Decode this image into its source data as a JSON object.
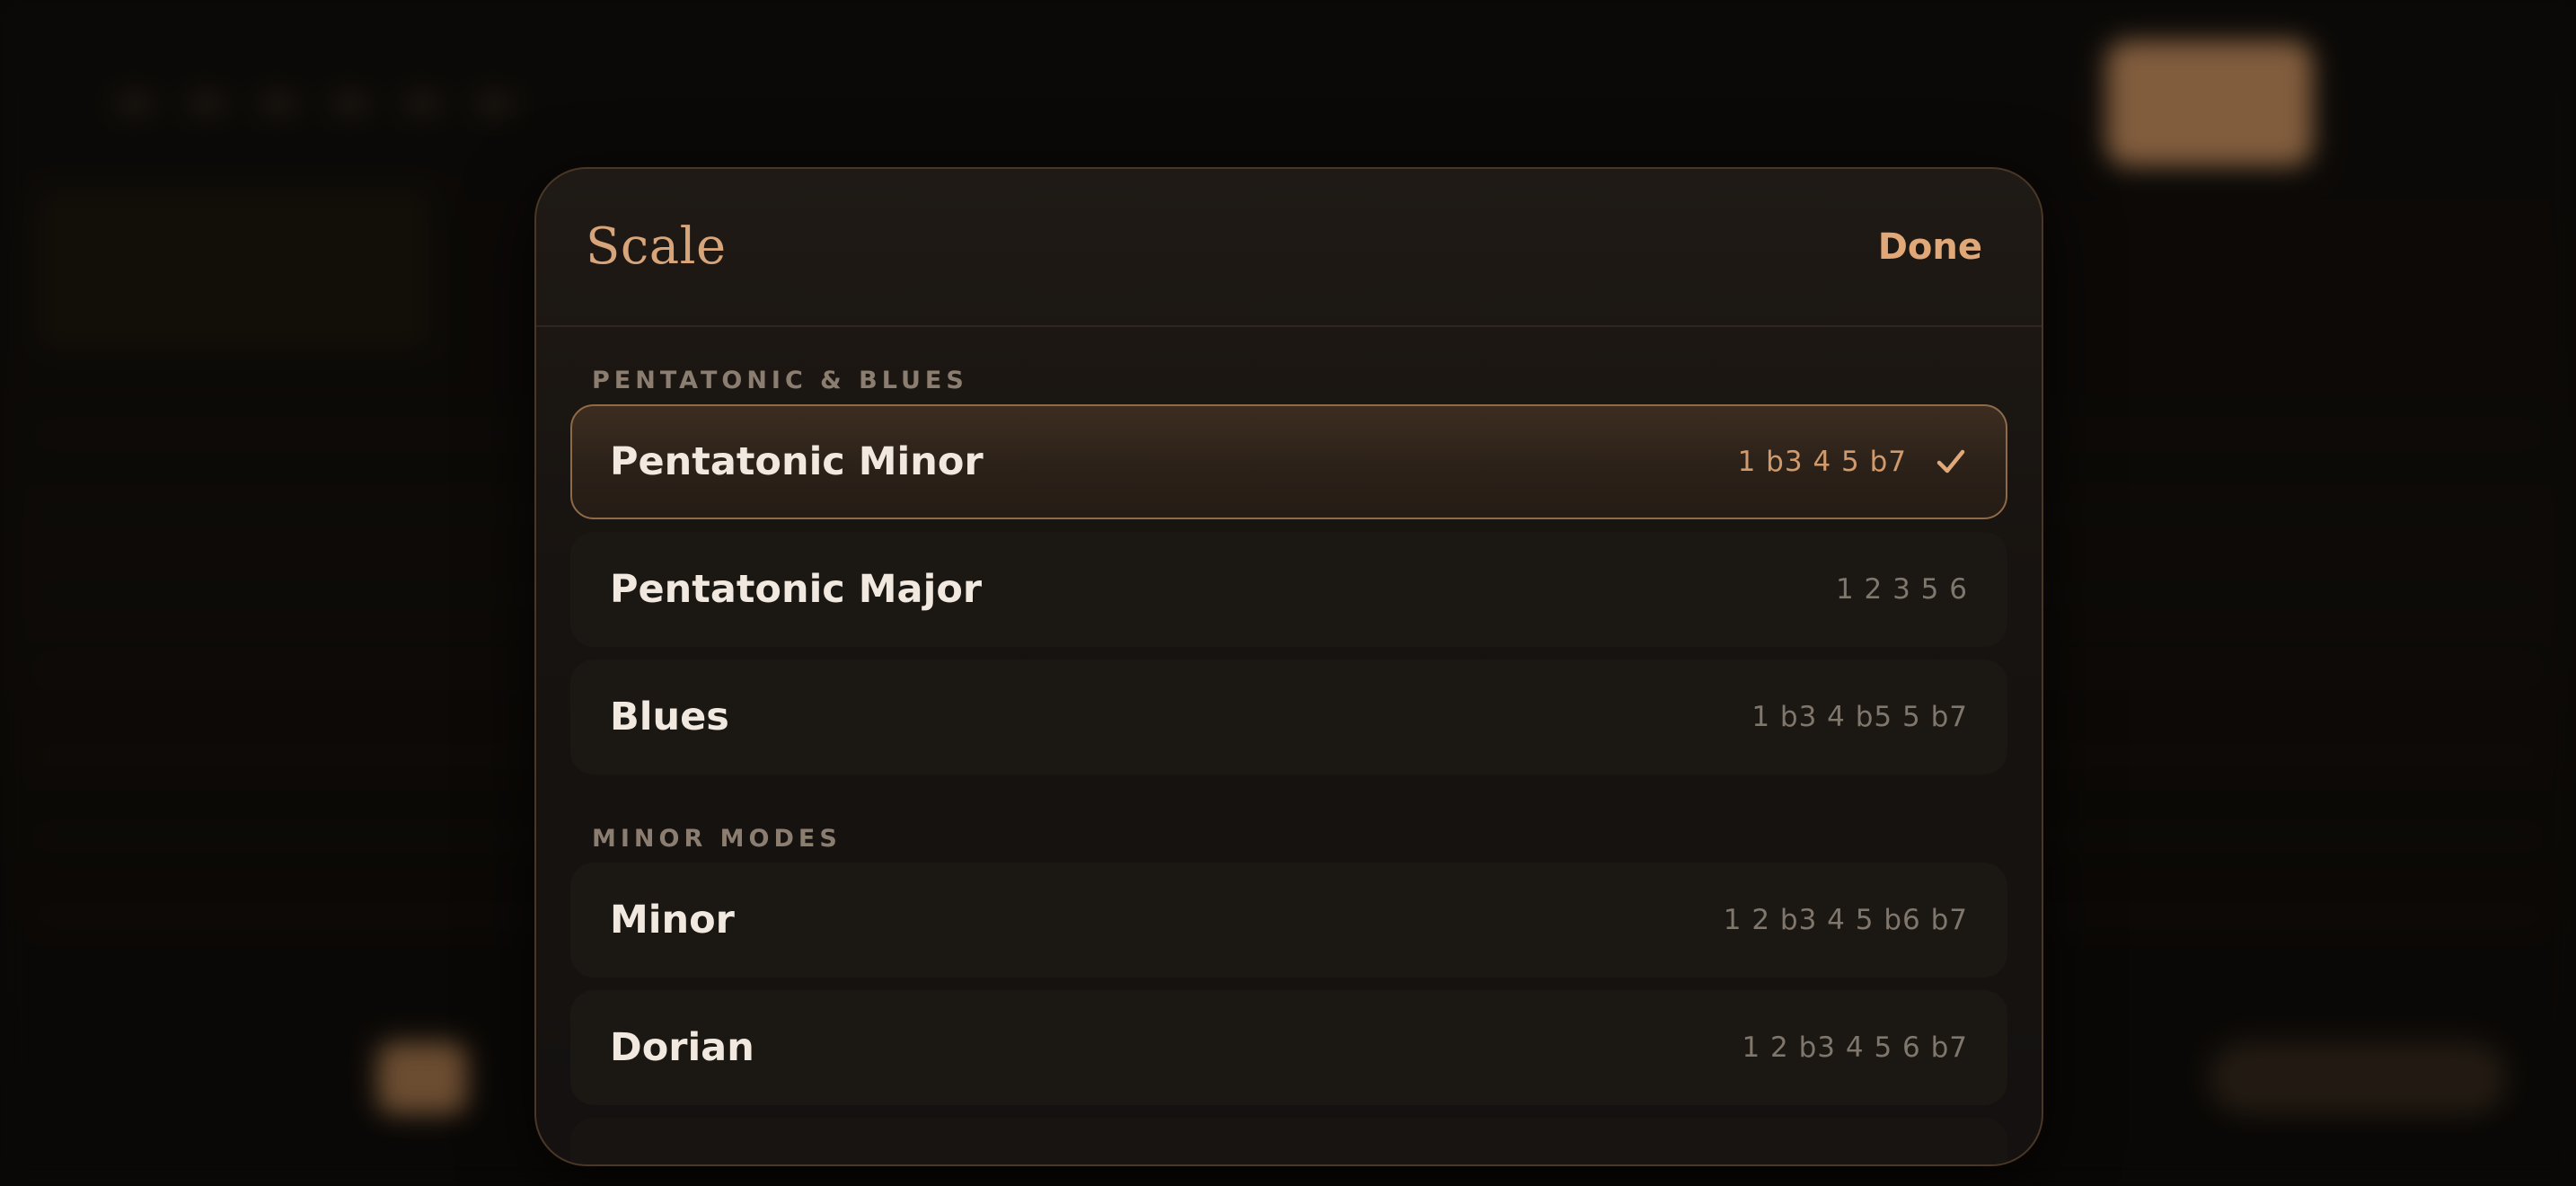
{
  "modal": {
    "title": "Scale",
    "done_label": "Done"
  },
  "sections": [
    {
      "label": "PENTATONIC & BLUES",
      "items": [
        {
          "name": "Pentatonic Minor",
          "degrees": "1 b3 4 5 b7",
          "selected": true
        },
        {
          "name": "Pentatonic Major",
          "degrees": "1 2 3 5 6",
          "selected": false
        },
        {
          "name": "Blues",
          "degrees": "1 b3 4 b5 5 b7",
          "selected": false
        }
      ]
    },
    {
      "label": "MINOR MODES",
      "items": [
        {
          "name": "Minor",
          "degrees": "1 2 b3 4 5 b6 b7",
          "selected": false
        },
        {
          "name": "Dorian",
          "degrees": "1 2 b3 4 5 6 b7",
          "selected": false
        }
      ]
    }
  ],
  "icons": {
    "selected_marker": "check-icon"
  },
  "colors": {
    "accent": "#e0a878",
    "title": "#d8a57a",
    "selected_border": "#8f6a48",
    "background": "#0a0806"
  }
}
